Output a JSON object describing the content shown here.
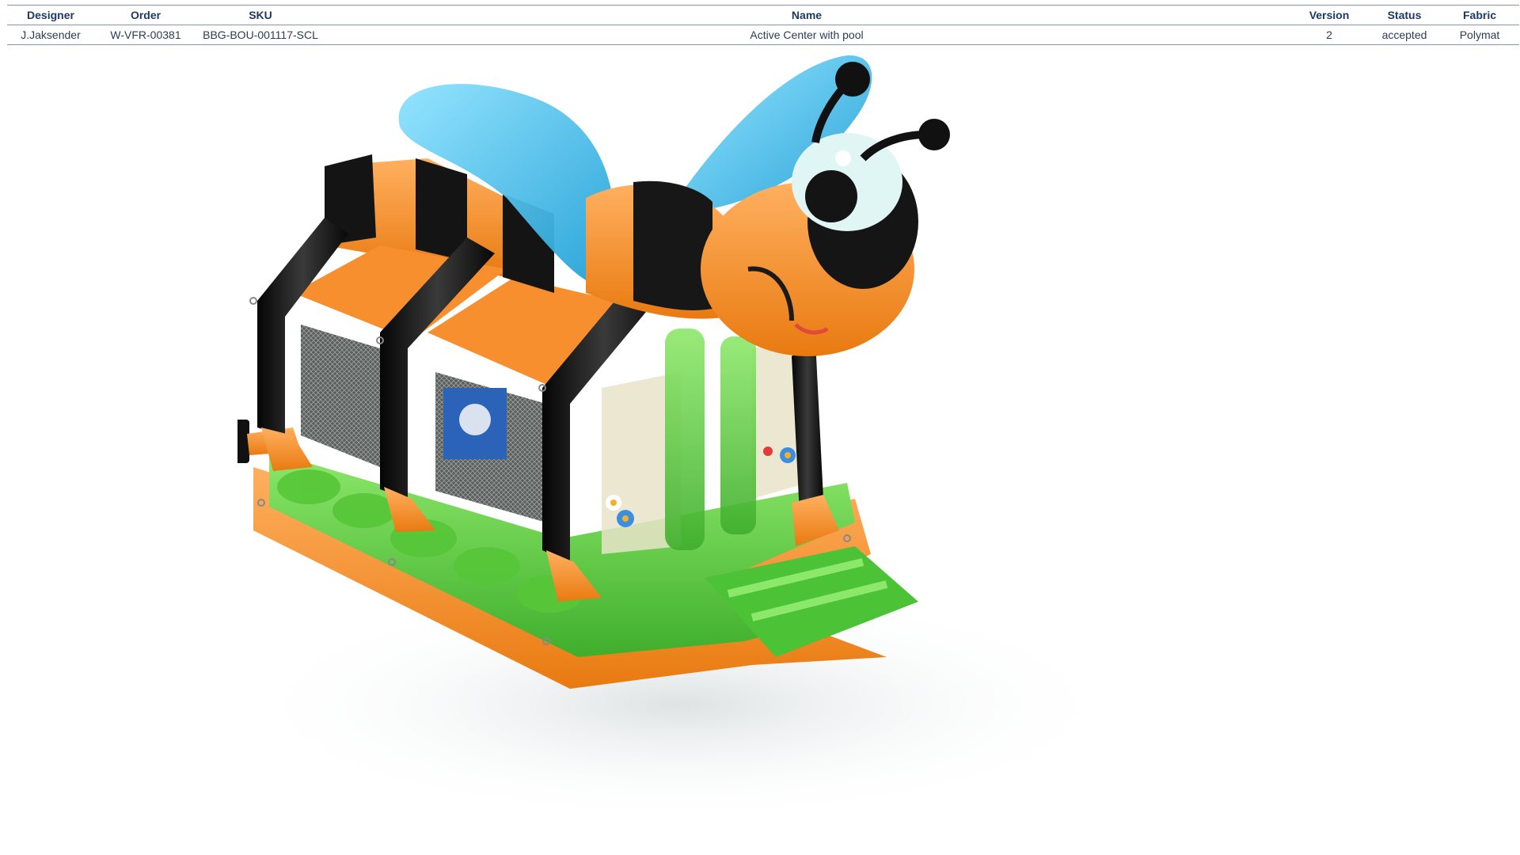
{
  "table": {
    "headers": {
      "designer": "Designer",
      "order": "Order",
      "sku": "SKU",
      "name": "Name",
      "version": "Version",
      "status": "Status",
      "fabric": "Fabric"
    },
    "row": {
      "designer": "J.Jaksender",
      "order": "W-VFR-00381",
      "sku": "BBG-BOU-001117-SCL",
      "name": "Active Center with pool",
      "version": "2",
      "status": "accepted",
      "fabric": "Polymat"
    }
  },
  "colors": {
    "orange": "#f7902a",
    "black": "#1a1a1a",
    "green": "#6fd44a",
    "wing_blue": "#4cc4ef",
    "eye_white": "#dff6f4",
    "header_text": "#1f3864"
  }
}
